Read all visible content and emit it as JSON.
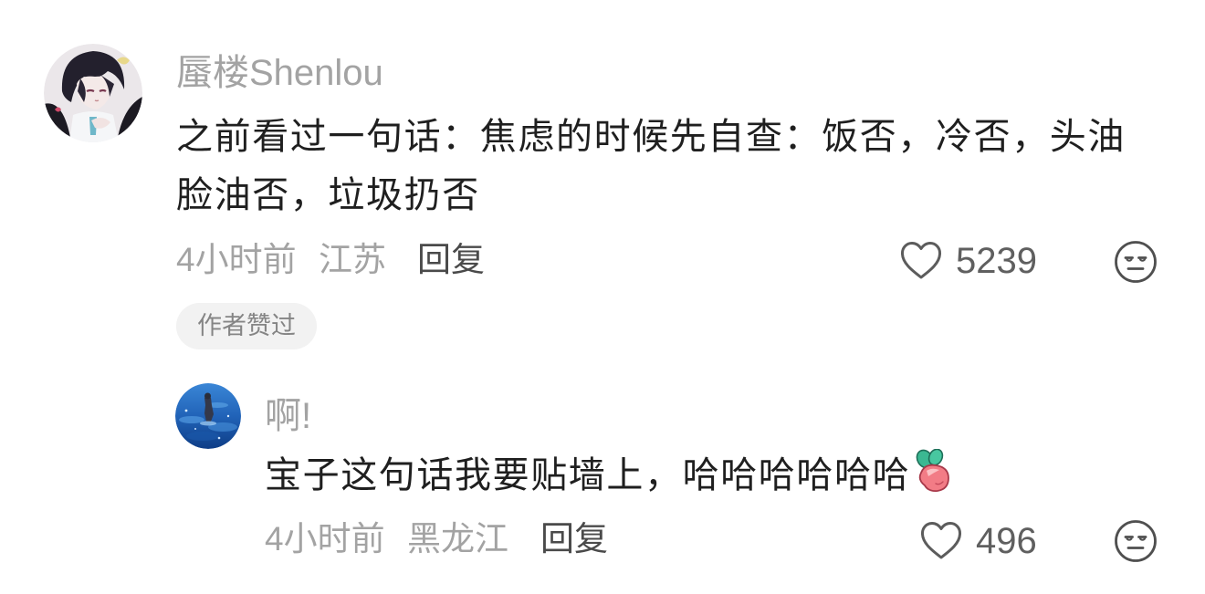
{
  "main_comment": {
    "avatar": "anime-character-avatar",
    "username": "蜃楼Shenlou",
    "text": "之前看过一句话：焦虑的时候先自查：饭否，冷否，头油脸油否，垃圾扔否",
    "time": "4小时前",
    "location": "江苏",
    "reply_label": "回复",
    "like_icon": "heart-outline-icon",
    "like_count": "5239",
    "dislike_icon": "meh-face-icon",
    "badge": "作者赞过"
  },
  "reply_comment": {
    "avatar": "ocean-photo-avatar",
    "username": "啊!",
    "text": "宝子这句话我要贴墙上，哈哈哈哈哈哈",
    "emoji": "radish-sticker-icon",
    "time": "4小时前",
    "location": "黑龙江",
    "reply_label": "回复",
    "like_icon": "heart-outline-icon",
    "like_count": "496",
    "dislike_icon": "meh-face-icon"
  },
  "colors": {
    "background": "#ffffff",
    "primary_text": "#1f1f1f",
    "secondary_text": "#a3a3a3",
    "action_text": "#4a4a4a",
    "icon": "#5c5c5c",
    "badge_background": "#f2f2f2"
  }
}
